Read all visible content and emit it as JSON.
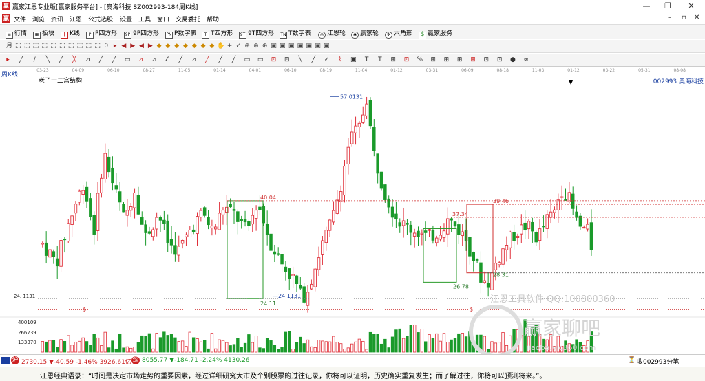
{
  "window": {
    "title": "赢家江恩专业版[赢家服务平台] - [奥海科技  SZ002993-184周K线]",
    "logo": "赢"
  },
  "menu": {
    "items": [
      "文件",
      "浏览",
      "资讯",
      "江恩",
      "公式选股",
      "设置",
      "工具",
      "窗口",
      "交易委托",
      "帮助"
    ]
  },
  "toolbar": {
    "items": [
      "行情",
      "板块",
      "K线",
      "P四方形",
      "9P四方形",
      "P数字表",
      "T四方形",
      "9T四方形",
      "T数字表",
      "江恩轮",
      "赢家轮",
      "六角形",
      "赢家服务"
    ]
  },
  "chart_header": {
    "period": "周K线",
    "indicator": "老子十二宫结构",
    "stock": "002993 奥海科技",
    "dates": [
      "03-23",
      "04-09",
      "06-10",
      "08-27",
      "11-05",
      "01-14",
      "04-01",
      "06-10",
      "08-19",
      "11-04",
      "01-12",
      "03-31",
      "06-09",
      "08-18",
      "11-03",
      "01-12",
      "03-22",
      "05-31",
      "08-08"
    ]
  },
  "annotations": {
    "high": "57.0131",
    "low_line": "24.1131",
    "low_box": "24.11",
    "box1_top": "40.04",
    "box2_top": "37.34",
    "box2_low": "26.78",
    "box3_top": "39.46",
    "box3_low": "28.31",
    "axis_price": "24. 1131",
    "vol_ticks": [
      "400109",
      "266739",
      "133370"
    ],
    "dollar": "$"
  },
  "watermark": {
    "line1": "江恩工具软件  QQ:100800360",
    "brand": "赢家聊吧",
    "url": "jiaoba.yjc360.com"
  },
  "status": {
    "sh_icon": "沪",
    "sh": "2730.15 ▼-40.59 -1.46% 3926.61亿",
    "sz_icon": "深",
    "sz": "8055.77 ▼-184.71 -2.24% 4130.26",
    "right": "收002993分笔"
  },
  "quote": {
    "text": "江恩经典语录：“时间是决定市场走势的重要因素，经过详细研究大市及个别股票的过往记录，你将可以证明，历史确实重复发生；而了解过往，你将可以预测将来。”。"
  },
  "colors": {
    "up": "#e0303a",
    "down": "#1a9a2a",
    "accent_blue": "#1a3fa0",
    "box_green": "#2a9a2a",
    "dashed_red": "#d03030"
  }
}
